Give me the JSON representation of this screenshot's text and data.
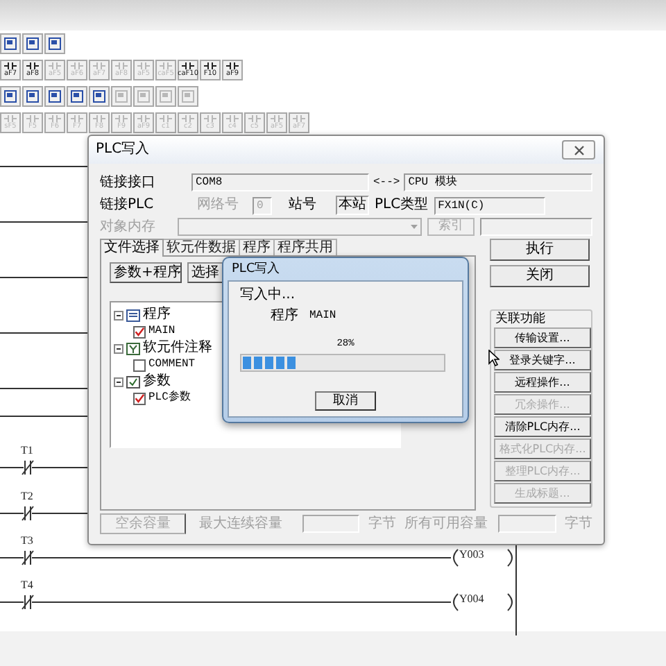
{
  "toolbars": [
    {
      "buttons": [
        {
          "kind": "icon",
          "disabled": false
        },
        {
          "kind": "icon",
          "disabled": false
        },
        {
          "kind": "icon",
          "disabled": false
        }
      ]
    },
    {
      "buttons": [
        {
          "kind": "key",
          "label": "aF7",
          "disabled": false
        },
        {
          "kind": "key",
          "label": "aF8",
          "disabled": false
        },
        {
          "kind": "key",
          "label": "aF5",
          "disabled": true
        },
        {
          "kind": "key",
          "label": "aF6",
          "disabled": true
        },
        {
          "kind": "key",
          "label": "aF7",
          "disabled": true
        },
        {
          "kind": "key",
          "label": "aF8",
          "disabled": true
        },
        {
          "kind": "key",
          "label": "aF5",
          "disabled": true
        },
        {
          "kind": "key",
          "label": "caF5",
          "disabled": true
        },
        {
          "kind": "key",
          "label": "caF10",
          "disabled": false
        },
        {
          "kind": "key",
          "label": "F10",
          "disabled": false
        },
        {
          "kind": "key",
          "label": "aF9",
          "disabled": false
        }
      ]
    },
    {
      "buttons": [
        {
          "kind": "icon",
          "disabled": false
        },
        {
          "kind": "icon",
          "disabled": false
        },
        {
          "kind": "icon",
          "disabled": false
        },
        {
          "kind": "icon",
          "disabled": false
        },
        {
          "kind": "icon",
          "disabled": false
        },
        {
          "kind": "icon",
          "disabled": true
        },
        {
          "kind": "icon",
          "disabled": true
        },
        {
          "kind": "icon",
          "disabled": true
        },
        {
          "kind": "icon",
          "disabled": true
        }
      ]
    },
    {
      "buttons": [
        {
          "kind": "key",
          "label": "sF5",
          "disabled": true
        },
        {
          "kind": "key",
          "label": "F5",
          "disabled": true
        },
        {
          "kind": "key",
          "label": "F6",
          "disabled": true
        },
        {
          "kind": "key",
          "label": "F7",
          "disabled": true
        },
        {
          "kind": "key",
          "label": "F8",
          "disabled": true
        },
        {
          "kind": "key",
          "label": "F9",
          "disabled": true
        },
        {
          "kind": "key",
          "label": "aF9",
          "disabled": true
        },
        {
          "kind": "key",
          "label": "c1",
          "disabled": true
        },
        {
          "kind": "key",
          "label": "c2",
          "disabled": true
        },
        {
          "kind": "key",
          "label": "c3",
          "disabled": true
        },
        {
          "kind": "key",
          "label": "c4",
          "disabled": true
        },
        {
          "kind": "key",
          "label": "c5",
          "disabled": true
        },
        {
          "kind": "key",
          "label": "aF5",
          "disabled": true
        },
        {
          "kind": "key",
          "label": "aF7",
          "disabled": true
        }
      ]
    }
  ],
  "ladder": {
    "rungs": [
      {
        "contact": "T1"
      },
      {
        "contact": "T2"
      },
      {
        "contact": "T3",
        "coil": "Y003"
      },
      {
        "contact": "T4",
        "coil": "Y004"
      }
    ]
  },
  "dialog": {
    "title": "PLC写入",
    "connection": {
      "label": "链接接口",
      "port": "COM8",
      "arrow": "<-->",
      "target": "CPU 模块"
    },
    "plc": {
      "label": "链接PLC",
      "network_label": "网络号",
      "network": "0",
      "network_disabled": true,
      "station_label": "站号",
      "station": "本站",
      "type_label": "PLC类型",
      "type": "FX1N(C)"
    },
    "memory": {
      "label": "对象内存",
      "index_button": "索引",
      "disabled": true
    },
    "tabs": [
      {
        "label": "文件选择",
        "selected": true
      },
      {
        "label": "软元件数据",
        "selected": false
      },
      {
        "label": "程序",
        "selected": false
      },
      {
        "label": "程序共用",
        "selected": false
      }
    ],
    "buttons": [
      {
        "label": "参数+程序"
      },
      {
        "label": "选择"
      }
    ],
    "tree": [
      {
        "label": "程序",
        "kind": "program",
        "expanded": true,
        "children": [
          {
            "label": "MAIN",
            "checked": true
          }
        ]
      },
      {
        "label": "软元件注释",
        "kind": "comment",
        "expanded": true,
        "children": [
          {
            "label": "COMMENT",
            "checked": false
          }
        ]
      },
      {
        "label": "参数",
        "kind": "parameter",
        "expanded": true,
        "children": [
          {
            "label": "PLC参数",
            "checked": true
          }
        ]
      }
    ],
    "actions": [
      {
        "label": "执行"
      },
      {
        "label": "关闭"
      }
    ],
    "related": {
      "title": "关联功能",
      "buttons": [
        {
          "label": "传输设置...",
          "disabled": false
        },
        {
          "label": "登录关键字...",
          "disabled": false
        },
        {
          "label": "远程操作...",
          "disabled": false
        },
        {
          "label": "冗余操作...",
          "disabled": true
        },
        {
          "label": "清除PLC内存...",
          "disabled": false
        },
        {
          "label": "格式化PLC内存...",
          "disabled": true
        },
        {
          "label": "整理PLC内存...",
          "disabled": true
        },
        {
          "label": "生成标题...",
          "disabled": true
        }
      ]
    },
    "capacity": {
      "button": "空余容量",
      "disabled": true,
      "max_label": "最大连续容量",
      "max_unit": "字节",
      "all_label": "所有可用容量",
      "all_unit": "字节"
    }
  },
  "progress_dialog": {
    "title": "PLC写入",
    "status": "写入中...",
    "item_label": "程序",
    "item": "MAIN",
    "percent": "28%",
    "level": 0.28,
    "cancel": "取消"
  }
}
